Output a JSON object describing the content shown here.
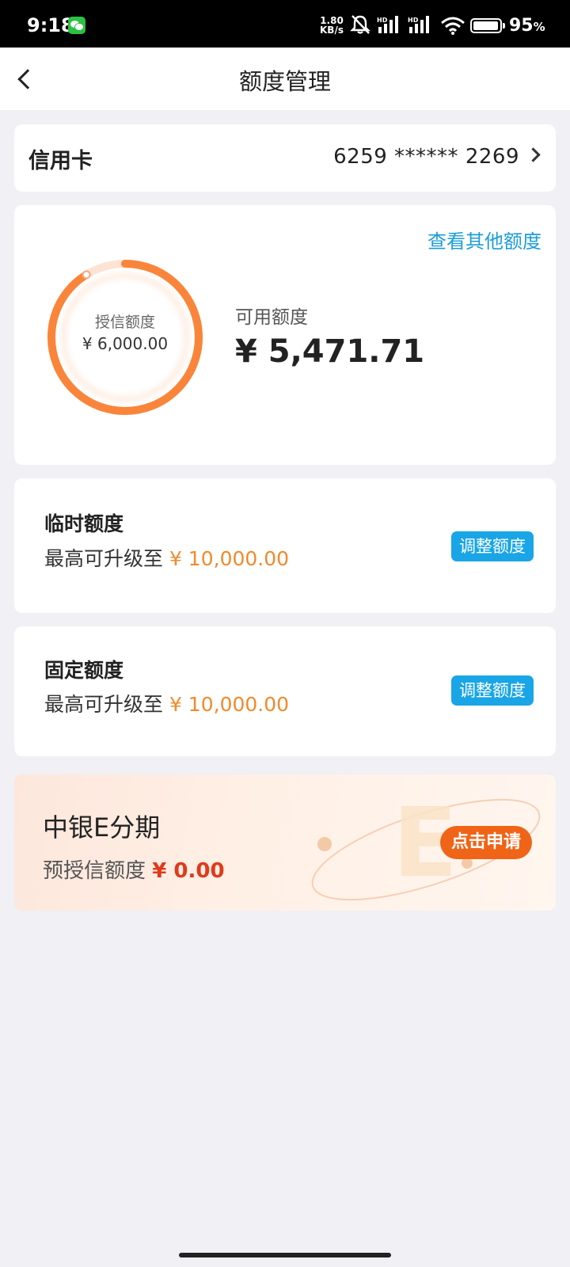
{
  "status_bar": {
    "time": "9:18",
    "net_speed_value": "1.80",
    "net_speed_unit": "KB/s",
    "hd_label": "HD",
    "battery_percent": "95",
    "battery_unit": "%"
  },
  "header": {
    "title": "额度管理"
  },
  "card_row": {
    "type": "信用卡",
    "number": "6259 ****** 2269"
  },
  "credit": {
    "view_other_link": "查看其他额度",
    "ring_label": "授信额度",
    "ring_value": "¥ 6,000.00",
    "available_label": "可用额度",
    "available_value": "¥ 5,471.71",
    "available_fraction": 0.912,
    "ring_color": "#f9853b"
  },
  "temp_limit": {
    "title": "临时额度",
    "desc_prefix": "最高可升级至 ",
    "amount": "¥ 10,000.00",
    "button": "调整额度"
  },
  "fixed_limit": {
    "title": "固定额度",
    "desc_prefix": "最高可升级至 ",
    "amount": "¥ 10,000.00",
    "button": "调整额度"
  },
  "installment": {
    "title": "中银E分期",
    "desc_prefix": "预授信额度 ",
    "amount": "¥ 0.00",
    "button": "点击申请",
    "logo_letter": "E"
  },
  "colors": {
    "accent_blue": "#19a5e6",
    "accent_orange": "#f08a2c",
    "apply_orange": "#f06418",
    "red_amount": "#e0391c"
  }
}
